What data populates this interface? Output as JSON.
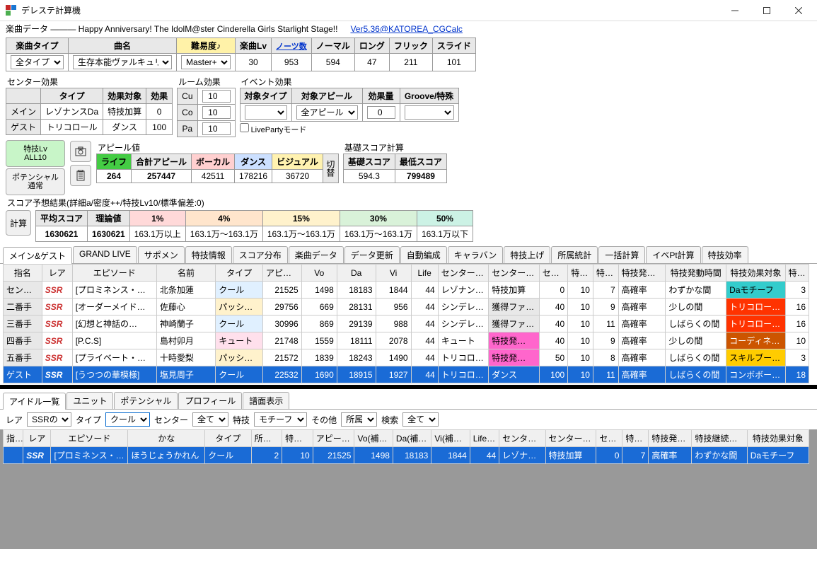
{
  "window": {
    "title": "デレステ計算機"
  },
  "top": {
    "label": "楽曲データ ――― Happy Anniversary! The IdolM@ster Cinderella Girls Starlight Stage!!",
    "version": "Ver5.36@KATOREA_CGCalc"
  },
  "song": {
    "headers": [
      "楽曲タイプ",
      "曲名",
      "難易度♪",
      "楽曲Lv",
      "ノーツ数",
      "ノーマル",
      "ロング",
      "フリック",
      "スライド"
    ],
    "type": "全タイプ",
    "name": "生存本能ヴァルキュリア",
    "diff": "Master+",
    "lv": "30",
    "notes": "953",
    "normal": "594",
    "long": "47",
    "flick": "211",
    "slide": "101"
  },
  "center": {
    "title": "センター効果",
    "cols": [
      "",
      "タイプ",
      "効果対象",
      "効果"
    ],
    "rows": [
      {
        "slot": "メイン",
        "type": "レゾナンスDa",
        "target": "特技加算",
        "val": "0"
      },
      {
        "slot": "ゲスト",
        "type": "トリコロール",
        "target": "ダンス",
        "val": "100"
      }
    ]
  },
  "room": {
    "title": "ルーム効果",
    "rows": [
      [
        "Cu",
        "10"
      ],
      [
        "Co",
        "10"
      ],
      [
        "Pa",
        "10"
      ]
    ]
  },
  "event": {
    "title": "イベント効果",
    "cols": [
      "対象タイプ",
      "対象アピール",
      "効果量",
      "Groove/特殊"
    ],
    "type": "",
    "appeal": "全アピール",
    "amount": "0",
    "groove": "",
    "liveparty": "LivePartyモード"
  },
  "buttons": {
    "allLv": "特技Lv\nALL10",
    "potential": "ポテンシャル\n通常"
  },
  "appeal": {
    "title": "アピール値",
    "cols": [
      "ライフ",
      "合計アピール",
      "ボーカル",
      "ダンス",
      "ビジュアル"
    ],
    "vals": [
      "264",
      "257447",
      "42511",
      "178216",
      "36720"
    ],
    "toggle": "切替"
  },
  "basescore": {
    "title": "基礎スコア計算",
    "cols": [
      "基礎スコア",
      "最低スコア"
    ],
    "vals": [
      "594.3",
      "799489"
    ]
  },
  "scoreHdr": "スコア予想結果(詳細a/密度++/特技Lv10/標準偏差:0)",
  "score": {
    "cols": [
      "平均スコア",
      "理論値",
      "1%",
      "4%",
      "15%",
      "30%",
      "50%"
    ],
    "vals": [
      "1630621",
      "1630621",
      "163.1万以上",
      "163.1万～163.1万",
      "163.1万～163.1万",
      "163.1万～163.1万",
      "163.1万以下"
    ],
    "calc": "計算"
  },
  "tabs": [
    "メイン&ゲスト",
    "GRAND LIVE",
    "サポメン",
    "特技情報",
    "スコア分布",
    "楽曲データ",
    "データ更新",
    "自動編成",
    "キャラバン",
    "特技上げ",
    "所属統計",
    "一括計算",
    "イベPt計算",
    "特技効率"
  ],
  "mainGrid": {
    "cols": [
      "指名",
      "レア",
      "エピソード",
      "名前",
      "タイプ",
      "アピール合計",
      "Vo",
      "Da",
      "Vi",
      "Life",
      "センター効果タイプ",
      "センター効果対象",
      "センター効",
      "特技レベル",
      "特技発動",
      "特技発動率",
      "特技発動時間",
      "特技効果対象",
      "特技効率"
    ],
    "rows": [
      {
        "slot": "センター",
        "rare": "SSR",
        "ep": "[プロミネンス・プ…",
        "name": "北条加蓮",
        "type": "クール",
        "tcls": "tt-cool",
        "ap": "21525",
        "vo": "1498",
        "da": "18183",
        "vi": "1844",
        "life": "44",
        "ce1": "レゾナン…",
        "ce2": "特技加算",
        "ce2cls": "",
        "cev": "0",
        "slv": "10",
        "skn": "7",
        "srate": "高確率",
        "stime": "わずかな間",
        "seff": "Daモチーフ",
        "secls": "et-da",
        "sev": "3",
        "sel": false
      },
      {
        "slot": "二番手",
        "rare": "SSR",
        "ep": "[オーダーメイド・…",
        "name": "佐藤心",
        "type": "パッション",
        "tcls": "tt-pass",
        "ap": "29756",
        "vo": "669",
        "da": "28131",
        "vi": "956",
        "life": "44",
        "ce1": "シンデレ…",
        "ce2": "獲得ファ…",
        "ce2cls": "et-fan",
        "cev": "40",
        "slv": "10",
        "skn": "9",
        "srate": "高確率",
        "stime": "少しの間",
        "seff": "トリコロール…",
        "secls": "et-trico",
        "sev": "16",
        "sel": false
      },
      {
        "slot": "三番手",
        "rare": "SSR",
        "ep": "[幻想と神話の…",
        "name": "神崎蘭子",
        "type": "クール",
        "tcls": "tt-cool",
        "ap": "30996",
        "vo": "869",
        "da": "29139",
        "vi": "988",
        "life": "44",
        "ce1": "シンデレ…",
        "ce2": "獲得ファ…",
        "ce2cls": "et-fan",
        "cev": "40",
        "slv": "10",
        "skn": "11",
        "srate": "高確率",
        "stime": "しばらくの間",
        "seff": "トリコロール…",
        "secls": "et-trico",
        "sev": "16",
        "sel": false
      },
      {
        "slot": "四番手",
        "rare": "SSR",
        "ep": "[P.C.S]",
        "name": "島村卯月",
        "type": "キュート",
        "tcls": "tt-cute",
        "ap": "21748",
        "vo": "1559",
        "da": "18111",
        "vi": "2078",
        "life": "44",
        "ce1": "キュート",
        "ce2": "特技発…",
        "ce2cls": "et-tokki",
        "cev": "40",
        "slv": "10",
        "skn": "9",
        "srate": "高確率",
        "stime": "少しの間",
        "seff": "コーディネイト",
        "secls": "et-coord",
        "sev": "10",
        "sel": false
      },
      {
        "slot": "五番手",
        "rare": "SSR",
        "ep": "[プライベート・メ…",
        "name": "十時愛梨",
        "type": "パッション",
        "tcls": "tt-pass",
        "ap": "21572",
        "vo": "1839",
        "da": "18243",
        "vi": "1490",
        "life": "44",
        "ce1": "トリコロ…",
        "ce2": "特技発…",
        "ce2cls": "et-tokki",
        "cev": "50",
        "slv": "10",
        "skn": "8",
        "srate": "高確率",
        "stime": "しばらくの間",
        "seff": "スキルブー…",
        "secls": "et-skill",
        "sev": "3",
        "sel": false
      },
      {
        "slot": "ゲスト",
        "rare": "SSR",
        "ep": "[うつつの華模様]",
        "name": "塩見周子",
        "type": "クール",
        "tcls": "tt-cool",
        "ap": "22532",
        "vo": "1690",
        "da": "18915",
        "vi": "1927",
        "life": "44",
        "ce1": "トリコロ…",
        "ce2": "ダンス",
        "ce2cls": "et-dance",
        "cev": "100",
        "slv": "10",
        "skn": "11",
        "srate": "高確率",
        "stime": "しばらくの間",
        "seff": "コンボボー…",
        "secls": "et-combo",
        "sev": "18",
        "sel": true
      }
    ]
  },
  "lowerTabs": [
    "アイドル一覧",
    "ユニット",
    "ポテンシャル",
    "プロフィール",
    "譜面表示"
  ],
  "filter": {
    "rare": "レア",
    "rareOpt": "SSRの",
    "type": "タイプ",
    "typeOpt": "クール",
    "center": "センター",
    "centerOpt": "全て",
    "skill": "特技",
    "skillOpt": "モチーフ",
    "etc": "その他",
    "etcOpt": "所属",
    "search": "検索",
    "searchOpt": "全て"
  },
  "lowerGrid": {
    "cols": [
      "指名",
      "レア",
      "エピソード",
      "かな",
      "タイプ",
      "所属数",
      "特技Lv",
      "アピール合計(補",
      "Vo(補正(後)",
      "Da(補正(後)",
      "Vi(補正(後)",
      "Life(補正",
      "センター効果タイプ",
      "センター効果対象",
      "センター効",
      "特技発動",
      "特技発動率",
      "特技継続時間",
      "特技効果対象"
    ],
    "row": {
      "rare": "SSR",
      "ep": "[プロミネンス・プ…",
      "kana": "ほうじょうかれん",
      "type": "クール",
      "cnt": "2",
      "slv": "10",
      "ap": "21525",
      "vo": "1498",
      "da": "18183",
      "vi": "1844",
      "life": "44",
      "ce1": "レゾナン…",
      "ce2": "特技加算",
      "cev": "0",
      "skn": "7",
      "srate": "高確率",
      "stime": "わずかな間",
      "seff": "Daモチーフ"
    }
  }
}
